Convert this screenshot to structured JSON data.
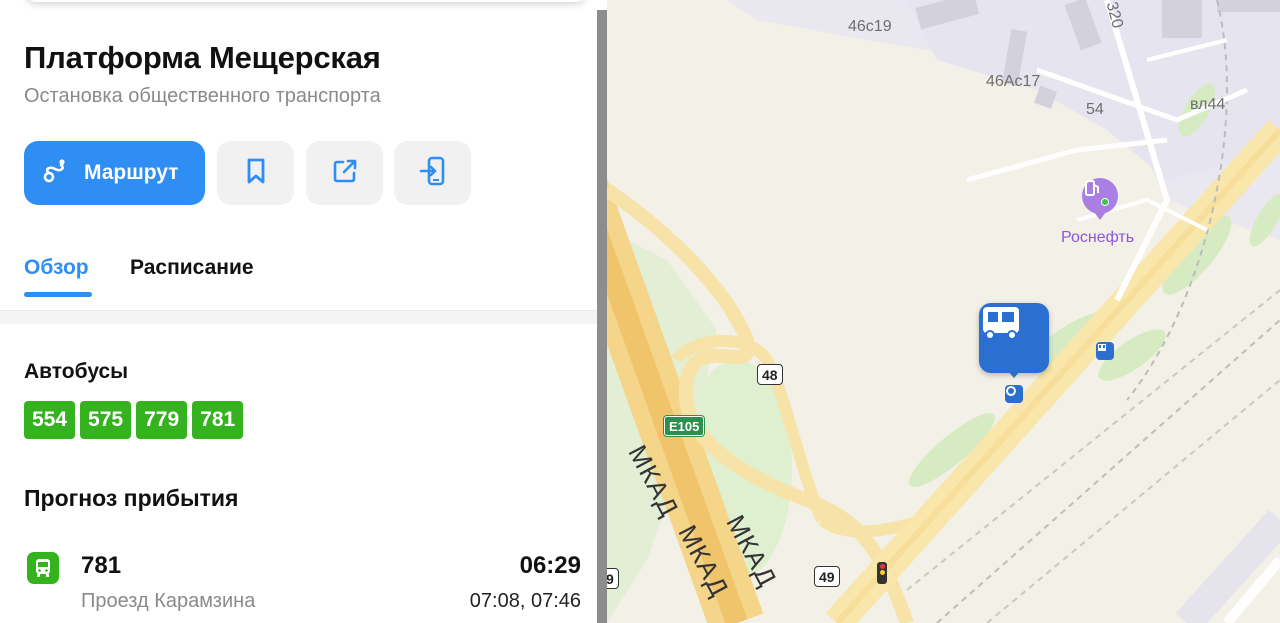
{
  "stop": {
    "title": "Платформа Мещерская",
    "subtitle": "Остановка общественного транспорта"
  },
  "actions": {
    "route_label": "Маршрут",
    "bookmark_icon": "bookmark-icon",
    "share_icon": "share-icon",
    "send_to_phone_icon": "send-to-phone-icon"
  },
  "tabs": [
    {
      "label": "Обзор",
      "active": true
    },
    {
      "label": "Расписание",
      "active": false
    }
  ],
  "buses": {
    "heading": "Автобусы",
    "routes": [
      "554",
      "575",
      "779",
      "781"
    ]
  },
  "forecast": {
    "heading": "Прогноз прибытия",
    "rows": [
      {
        "route": "781",
        "stop": "Проезд Карамзина",
        "time": "06:29",
        "next": "07:08, 07:46"
      }
    ]
  },
  "map": {
    "labels": [
      "46с19",
      "46Ас17",
      "54",
      "вл44"
    ],
    "poi": "Роснефть",
    "road_shields": [
      "48",
      "49",
      "9"
    ],
    "euro_route": "E105",
    "highway_name": "МКАД",
    "road_number_partial": "320"
  },
  "colors": {
    "accent": "#2f8ef4",
    "bus_green": "#35b31e",
    "stop_pin": "#2b6fd0",
    "poi_purple": "#8a57d6"
  }
}
